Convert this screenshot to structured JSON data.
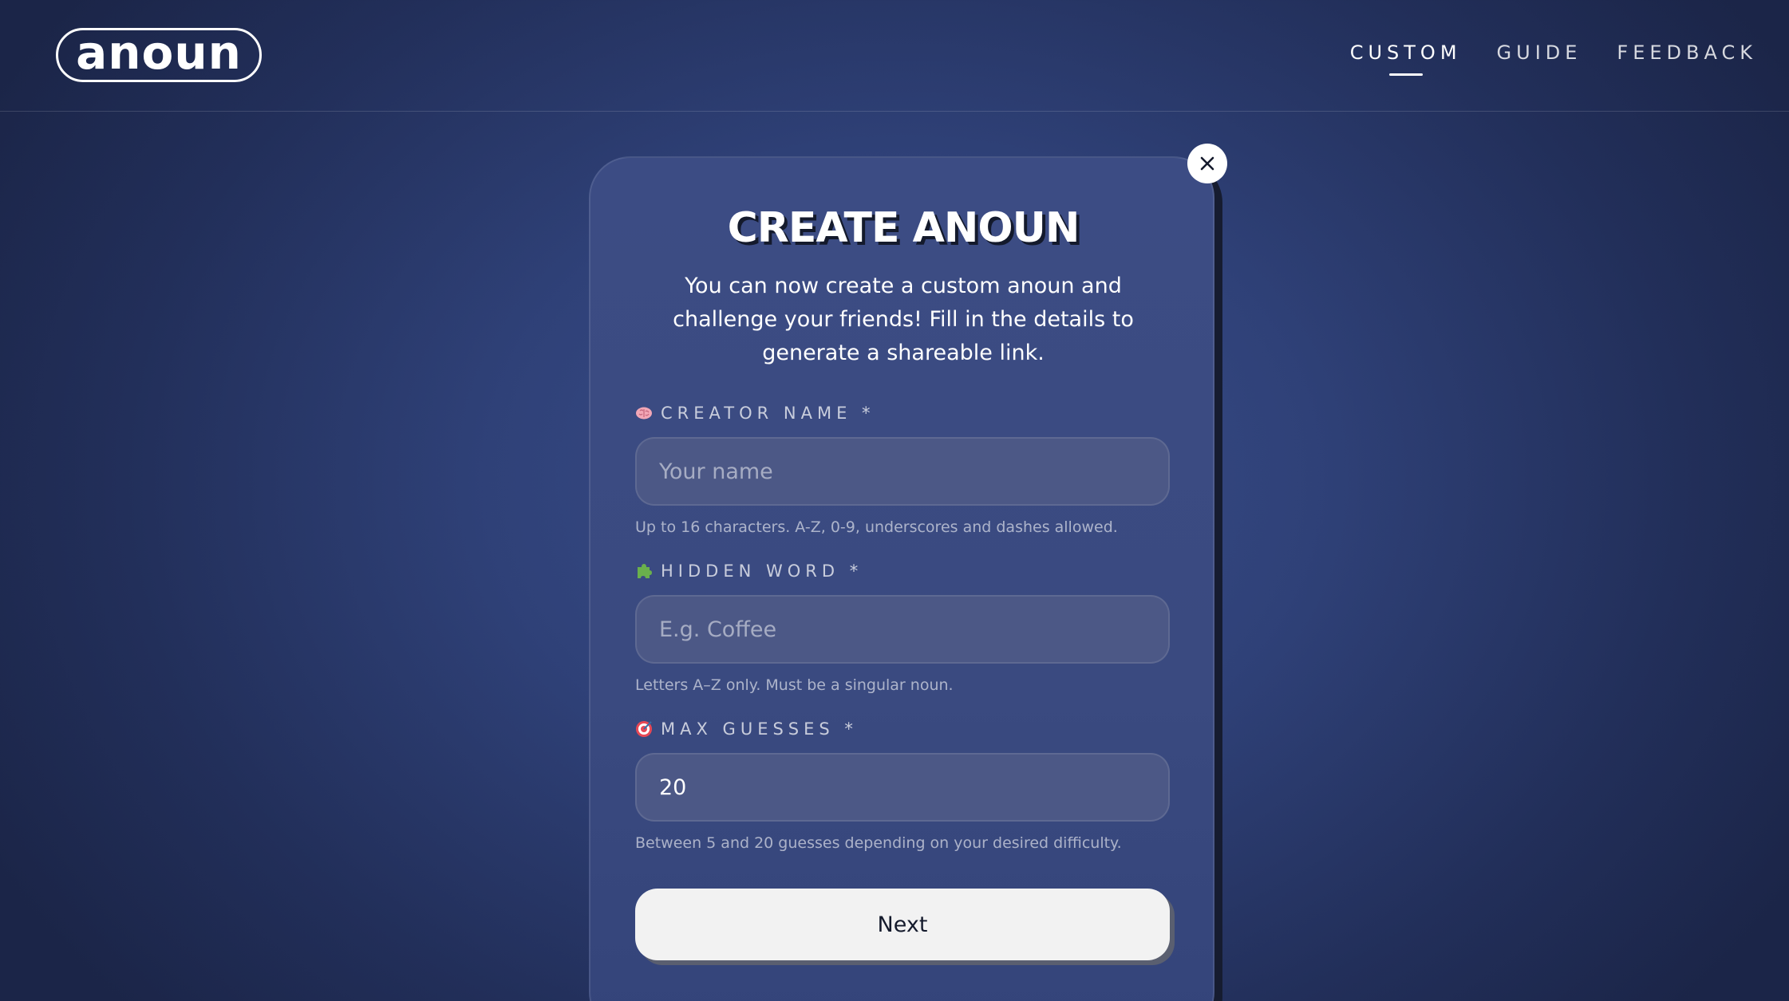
{
  "header": {
    "logo_text": "anoun",
    "nav": [
      {
        "label": "CUSTOM",
        "active": true
      },
      {
        "label": "GUIDE",
        "active": false
      },
      {
        "label": "FEEDBACK",
        "active": false
      }
    ]
  },
  "modal": {
    "title": "CREATE ANOUN",
    "description": "You can now create a custom anoun and challenge your friends! Fill in the details to generate a shareable link.",
    "fields": {
      "creator_name": {
        "icon": "brain-icon",
        "label": "CREATOR NAME *",
        "placeholder": "Your name",
        "value": "",
        "hint": "Up to 16 characters. A-Z, 0-9, underscores and dashes allowed."
      },
      "hidden_word": {
        "icon": "puzzle-icon",
        "label": "HIDDEN WORD *",
        "placeholder": "E.g. Coffee",
        "value": "",
        "hint": "Letters A–Z only. Must be a singular noun."
      },
      "max_guesses": {
        "icon": "target-icon",
        "label": "MAX GUESSES *",
        "placeholder": "",
        "value": "20",
        "hint": "Between 5 and 20 guesses depending on your desired difficulty."
      }
    },
    "next_label": "Next",
    "close_icon": "close-icon"
  },
  "colors": {
    "background": "#2f4178",
    "modal": "#3a4a80",
    "input": "#4c5886",
    "button": "#f2f2f2",
    "text_dark": "#141a2c"
  }
}
